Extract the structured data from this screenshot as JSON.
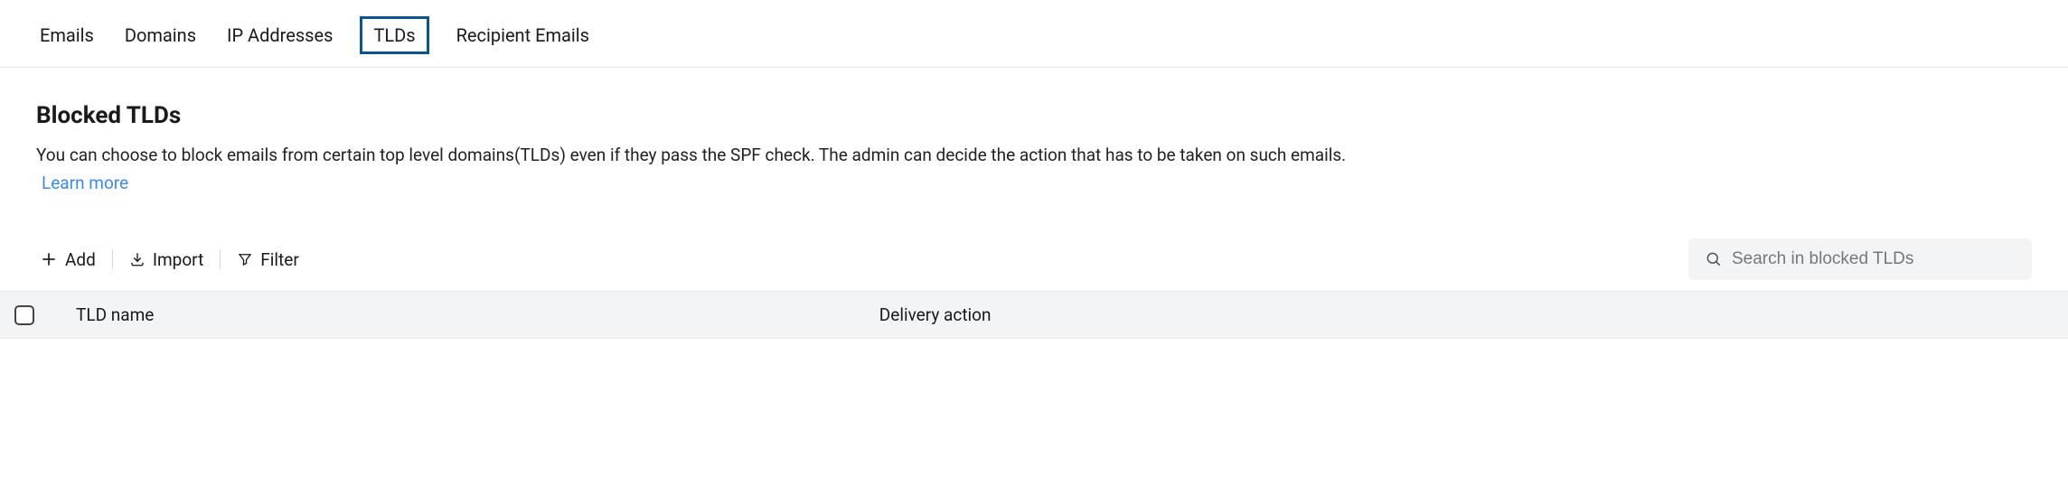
{
  "tabs": {
    "emails": "Emails",
    "domains": "Domains",
    "ip": "IP Addresses",
    "tlds": "TLDs",
    "recipient": "Recipient Emails"
  },
  "header": {
    "title": "Blocked TLDs",
    "description": "You can choose to block emails from certain top level domains(TLDs) even if they pass the SPF check. The admin can decide the action that has to be taken on such emails.",
    "learn_more": "Learn more"
  },
  "toolbar": {
    "add": "Add",
    "import": "Import",
    "filter": "Filter"
  },
  "search": {
    "placeholder": "Search in blocked TLDs"
  },
  "table": {
    "col_tld": "TLD name",
    "col_action": "Delivery action"
  }
}
